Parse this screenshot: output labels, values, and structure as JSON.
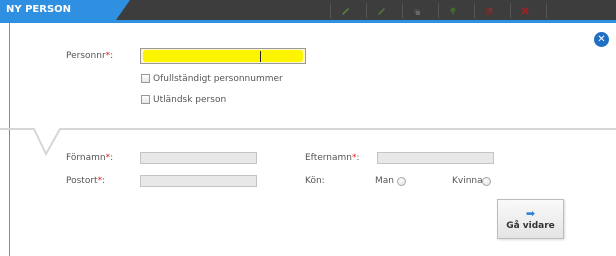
{
  "header": {
    "tab_title": "NY PERSON",
    "toolbar_icons": [
      "pencil-icon",
      "pencil-icon",
      "copy-icon",
      "pin-icon",
      "people-icon",
      "delete-icon"
    ]
  },
  "form": {
    "personnr_label": "Personnr",
    "required_mark": "*",
    "colon": ":",
    "incomplete_pnr_label": "Ofullständigt personnummer",
    "foreign_person_label": "Utländsk person",
    "fornamn_label": "Förnamn",
    "efternamn_label": "Efternamn",
    "postort_label": "Postort",
    "kon_label": "Kön:",
    "man_label": "Man",
    "kvinna_label": "Kvinna",
    "go_button_label": "Gå vidare"
  },
  "colors": {
    "accent": "#2f8fe0",
    "highlight": "#fdf500",
    "required": "#e02020"
  }
}
